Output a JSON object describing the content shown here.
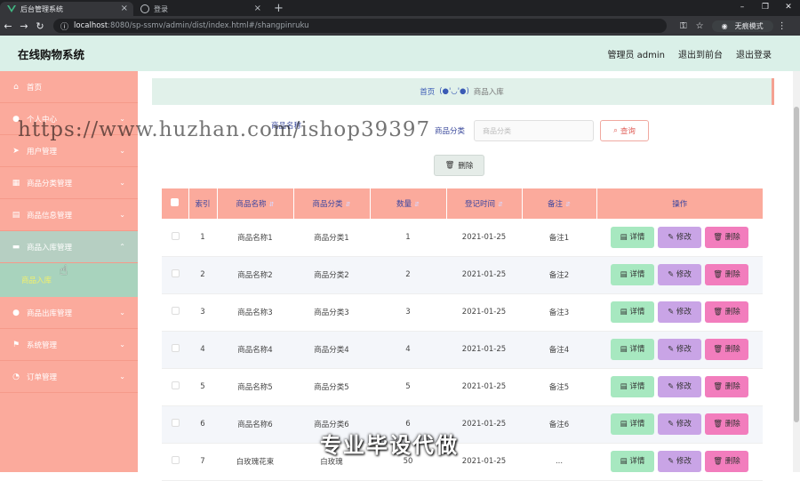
{
  "browser": {
    "tabs": [
      {
        "title": "后台管理系统",
        "active": true
      },
      {
        "title": "登录",
        "active": false
      }
    ],
    "url_host": "localhost",
    "url_path": ":8080/sp-ssmv/admin/dist/index.html#/shangpinruku",
    "incognito_label": "无痕模式"
  },
  "header": {
    "title": "在线购物系统",
    "user": "管理员 admin",
    "to_front": "退出到前台",
    "logout": "退出登录"
  },
  "sidebar": {
    "items": [
      {
        "label": "首页",
        "icon": "home-icon"
      },
      {
        "label": "个人中心",
        "icon": "user-icon"
      },
      {
        "label": "用户管理",
        "icon": "send-icon"
      },
      {
        "label": "商品分类管理",
        "icon": "grid-icon"
      },
      {
        "label": "商品信息管理",
        "icon": "clipboard-icon"
      },
      {
        "label": "商品入库管理",
        "icon": "ticket-icon"
      },
      {
        "label": "商品出库管理",
        "icon": "user-icon"
      },
      {
        "label": "系统管理",
        "icon": "flag-icon"
      },
      {
        "label": "订单管理",
        "icon": "gauge-icon"
      }
    ],
    "submenu_label": "商品入库"
  },
  "breadcrumb": {
    "home": "首页",
    "face": "(●'◡'●)",
    "current": "商品入库"
  },
  "search": {
    "name_label": "商品名称",
    "name_placeholder": "商品名称",
    "category_label": "商品分类",
    "category_placeholder": "商品分类",
    "query_label": "查询",
    "delete_label": "删除"
  },
  "table": {
    "headers": [
      "索引",
      "商品名称",
      "商品分类",
      "数量",
      "登记时间",
      "备注",
      "操作"
    ],
    "rows": [
      [
        "1",
        "商品名称1",
        "商品分类1",
        "1",
        "2021-01-25",
        "备注1"
      ],
      [
        "2",
        "商品名称2",
        "商品分类2",
        "2",
        "2021-01-25",
        "备注2"
      ],
      [
        "3",
        "商品名称3",
        "商品分类3",
        "3",
        "2021-01-25",
        "备注3"
      ],
      [
        "4",
        "商品名称4",
        "商品分类4",
        "4",
        "2021-01-25",
        "备注4"
      ],
      [
        "5",
        "商品名称5",
        "商品分类5",
        "5",
        "2021-01-25",
        "备注5"
      ],
      [
        "6",
        "商品名称6",
        "商品分类6",
        "6",
        "2021-01-25",
        "备注6"
      ],
      [
        "7",
        "白玫瑰花束",
        "白玫瑰",
        "50",
        "2021-01-25",
        "..."
      ]
    ],
    "action_labels": {
      "view": "详情",
      "edit": "修改",
      "delete": "删除"
    }
  },
  "overlay": {
    "watermark": "https://www.huzhan.com/ishop39397",
    "banner": "专业毕设代做"
  },
  "colors": {
    "sidebar": "#fbaa9c",
    "header": "#daf0e8",
    "view_btn": "#a7e8c0",
    "edit_btn": "#c9a4e6",
    "delete_btn": "#f27dbd"
  }
}
